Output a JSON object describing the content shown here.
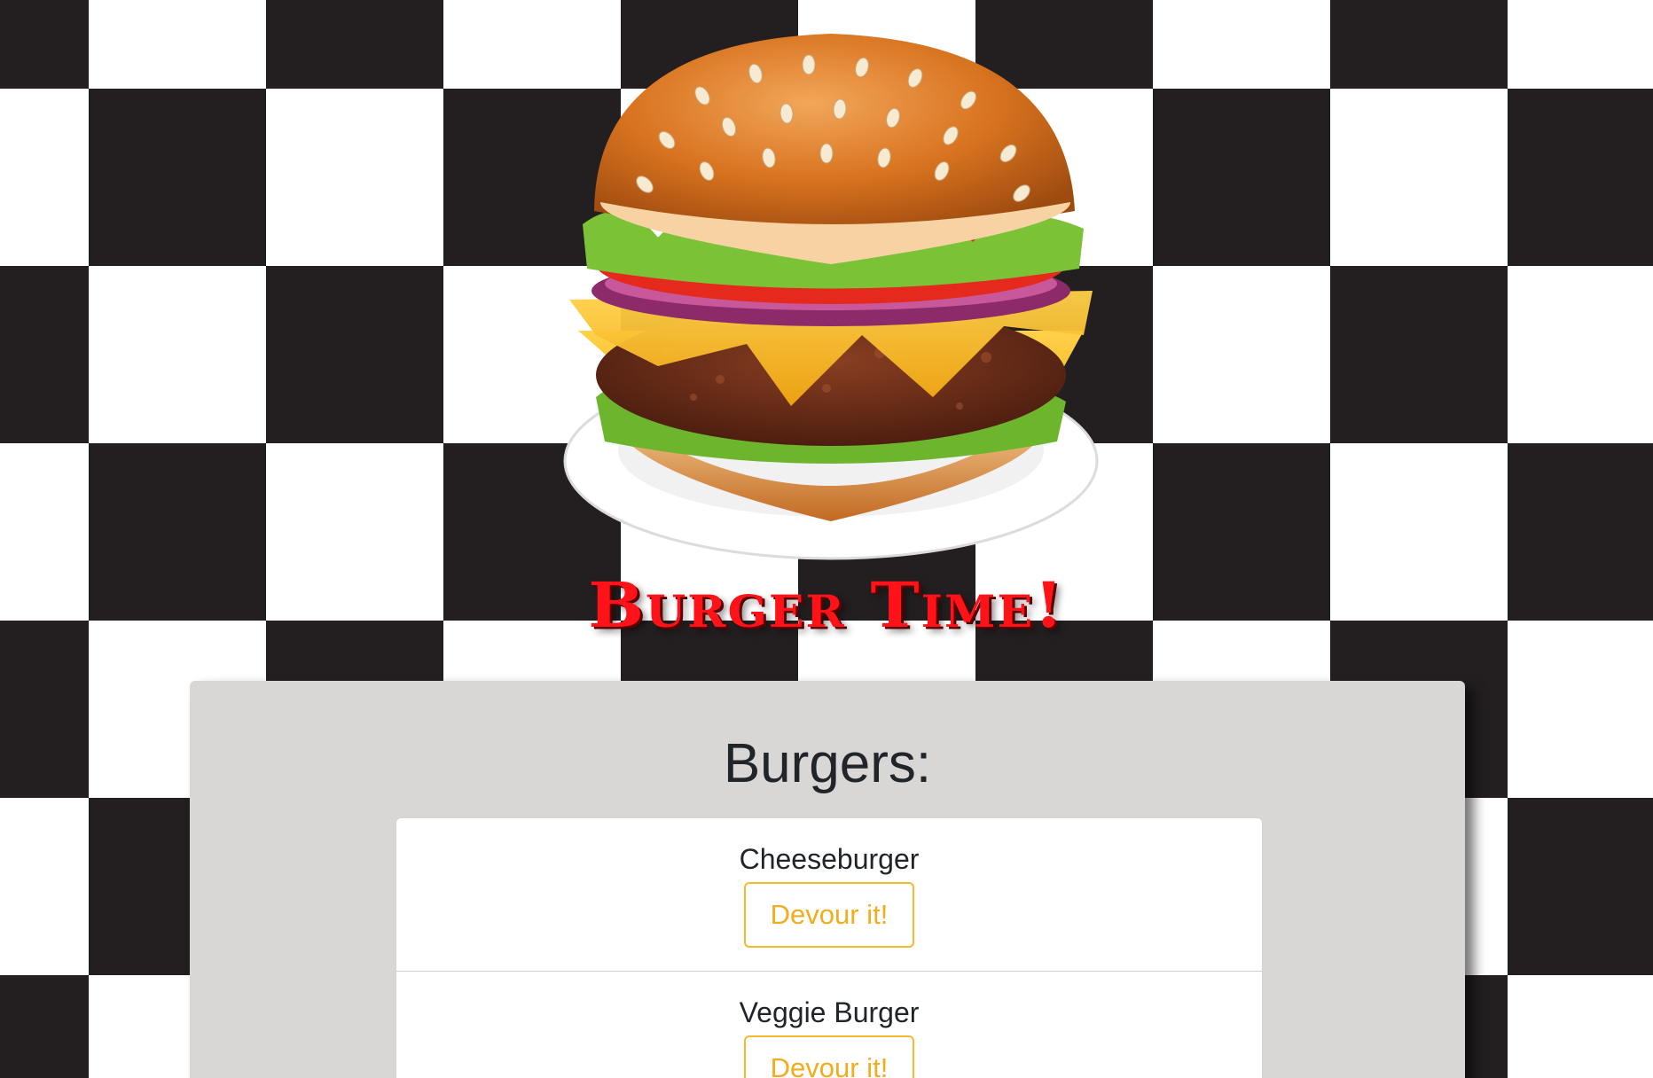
{
  "header": {
    "logo_icon": "burger-on-plate-icon",
    "title": "Burger Time!"
  },
  "panel": {
    "heading": "Burgers:"
  },
  "burgers": [
    {
      "name": "Cheeseburger",
      "action_label": "Devour it!"
    },
    {
      "name": "Veggie Burger",
      "action_label": "Devour it!"
    }
  ],
  "colors": {
    "title_red": "#ff1218",
    "panel_gray": "#d8d7d5",
    "button_border": "#f5b82e",
    "button_text": "#f0ad1c",
    "checker_dark": "#231f20"
  }
}
